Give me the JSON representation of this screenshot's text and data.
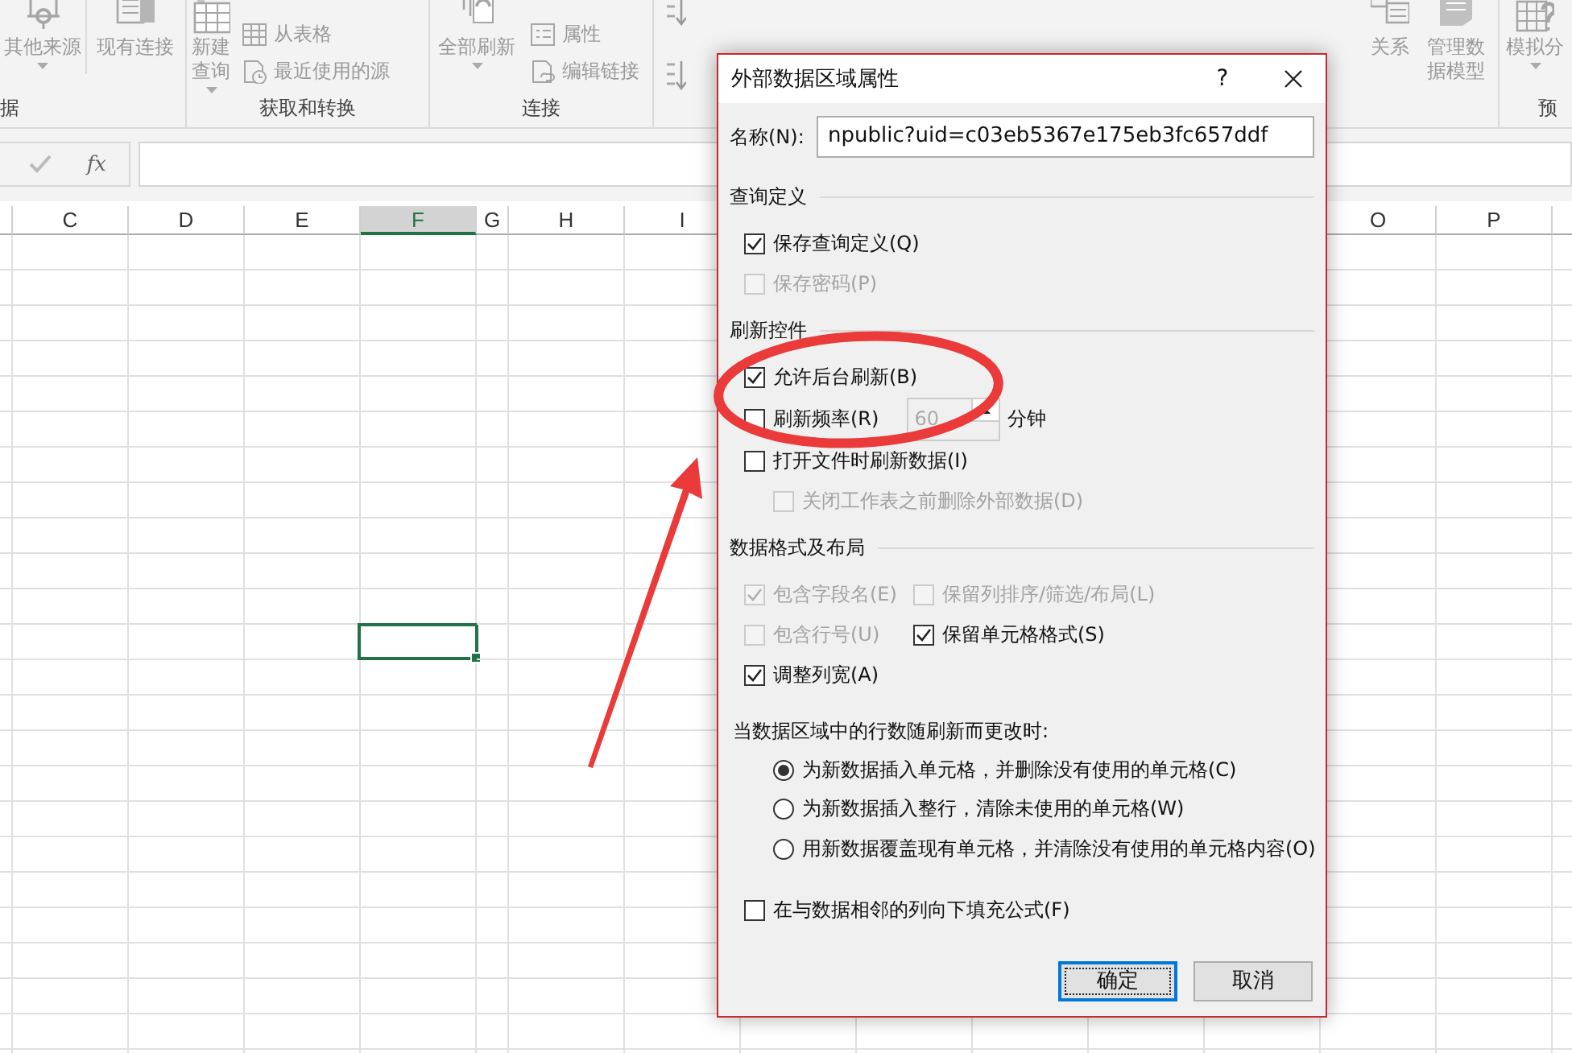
{
  "ribbon": {
    "groups": [
      {
        "label": "据",
        "items": [
          {
            "kind": "large",
            "label": "其他来源",
            "dropdown": true
          },
          {
            "kind": "large",
            "label": "现有连接",
            "dropdown": false
          }
        ]
      },
      {
        "label": "获取和转换",
        "items": [
          {
            "kind": "large",
            "label": "新建查询",
            "dropdown": true
          },
          {
            "kind": "small",
            "label": "从表格"
          },
          {
            "kind": "small",
            "label": "最近使用的源"
          }
        ]
      },
      {
        "label": "连接",
        "items": [
          {
            "kind": "large",
            "label": "全部刷新",
            "dropdown": true
          },
          {
            "kind": "small",
            "label": "属性"
          },
          {
            "kind": "small",
            "label": "编辑链接"
          }
        ]
      },
      {
        "items": [
          {
            "kind": "sort"
          }
        ]
      },
      {
        "items": [
          {
            "kind": "large",
            "label": "关系",
            "dropdown": false
          },
          {
            "kind": "large",
            "label": "管理数据模型",
            "dropdown": false
          }
        ]
      },
      {
        "label": "预",
        "items": [
          {
            "kind": "large",
            "label": "模拟分",
            "dropdown": true
          }
        ]
      }
    ]
  },
  "formula_bar": {
    "fx": "fx"
  },
  "sheet": {
    "columns": [
      {
        "label": "C",
        "selected": false
      },
      {
        "label": "D",
        "selected": false
      },
      {
        "label": "E",
        "selected": false
      },
      {
        "label": "F",
        "selected": true
      },
      {
        "label": "G",
        "selected": false
      },
      {
        "label": "H",
        "selected": false
      },
      {
        "label": "I",
        "selected": false
      },
      {
        "label": "O",
        "selected": false
      },
      {
        "label": "P",
        "selected": false
      }
    ]
  },
  "dialog": {
    "title": "外部数据区域属性",
    "help": "?",
    "name_label": "名称(N):",
    "name_value": "npublic?uid=c03eb5367e175eb3fc657ddf",
    "sections": [
      {
        "title": "查询定义",
        "options": [
          {
            "kind": "checkbox",
            "label": "保存查询定义(Q)",
            "checked": true,
            "disabled": false
          },
          {
            "kind": "checkbox",
            "label": "保存密码(P)",
            "checked": false,
            "disabled": true
          }
        ]
      },
      {
        "title": "刷新控件",
        "options": [
          {
            "kind": "checkbox",
            "label": "允许后台刷新(B)",
            "checked": true,
            "disabled": false
          },
          {
            "kind": "spin",
            "label": "刷新频率(R)",
            "checked": false,
            "disabled": false,
            "value": "60",
            "unit": "分钟"
          },
          {
            "kind": "checkbox",
            "label": "打开文件时刷新数据(I)",
            "checked": false,
            "disabled": false,
            "children": [
              {
                "kind": "checkbox",
                "label": "关闭工作表之前删除外部数据(D)",
                "checked": false,
                "disabled": true
              }
            ]
          }
        ]
      },
      {
        "title": "数据格式及布局",
        "options": [
          {
            "kind": "pair",
            "items": [
              {
                "kind": "checkbox",
                "label": "包含字段名(E)",
                "checked": true,
                "disabled": true
              },
              {
                "kind": "checkbox",
                "label": "保留列排序/筛选/布局(L)",
                "checked": false,
                "disabled": true
              }
            ]
          },
          {
            "kind": "pair",
            "items": [
              {
                "kind": "checkbox",
                "label": "包含行号(U)",
                "checked": false,
                "disabled": true
              },
              {
                "kind": "checkbox",
                "label": "保留单元格格式(S)",
                "checked": true,
                "disabled": false
              }
            ]
          },
          {
            "kind": "checkbox",
            "label": "调整列宽(A)",
            "checked": true,
            "disabled": false
          }
        ]
      }
    ],
    "row_change": {
      "prompt": "当数据区域中的行数随刷新而更改时:",
      "options": [
        {
          "label": "为新数据插入单元格，并删除没有使用的单元格(C)",
          "selected": true
        },
        {
          "label": "为新数据插入整行，清除未使用的单元格(W)",
          "selected": false
        },
        {
          "label": "用新数据覆盖现有单元格，并清除没有使用的单元格内容(O)",
          "selected": false
        }
      ]
    },
    "fill_down": {
      "label": "在与数据相邻的列向下填充公式(F)",
      "checked": false,
      "disabled": false
    },
    "buttons": [
      {
        "label": "确定",
        "default": true
      },
      {
        "label": "取消",
        "default": false
      }
    ]
  },
  "annotations": [
    {
      "kind": "ellipse"
    },
    {
      "kind": "arrow"
    }
  ]
}
